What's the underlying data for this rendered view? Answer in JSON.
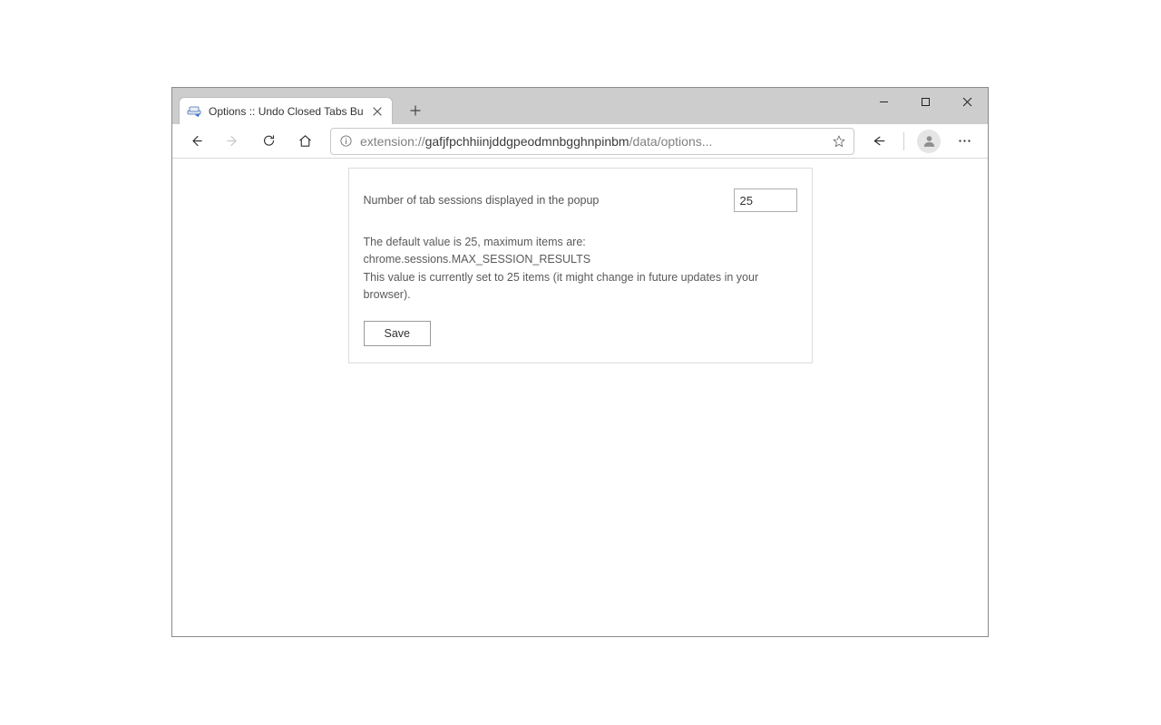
{
  "window": {
    "controls": {
      "minimize": "minimize",
      "maximize": "maximize",
      "close": "close"
    }
  },
  "tab": {
    "title": "Options :: Undo Closed Tabs Butt"
  },
  "address": {
    "prefix": "extension://",
    "host": "gafjfpchhiinjddgpeodmnbgghnpinbm",
    "path": "/data/options..."
  },
  "options": {
    "label": "Number of tab sessions displayed in the popup",
    "value": "25",
    "desc_line1": "The default value is 25, maximum items are: chrome.sessions.MAX_SESSION_RESULTS",
    "desc_line2": "This value is currently set to 25 items (it might change in future updates in your browser).",
    "save": "Save"
  }
}
